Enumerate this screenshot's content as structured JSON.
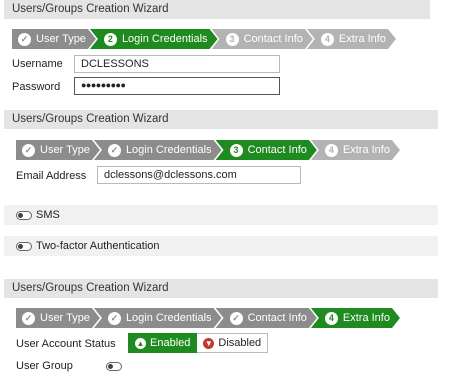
{
  "wizard_title": "Users/Groups Creation Wizard",
  "steps": [
    {
      "num": "",
      "label": "User Type"
    },
    {
      "num": "2",
      "label": "Login Credentials"
    },
    {
      "num": "3",
      "label": "Contact Info"
    },
    {
      "num": "4",
      "label": "Extra Info"
    }
  ],
  "check_glyph": "✓",
  "login": {
    "username_label": "Username",
    "username_value": "DCLESSONS",
    "password_label": "Password",
    "password_value": "●●●●●●●●●"
  },
  "contact": {
    "email_label": "Email Address",
    "email_value": "dclessons@dclessons.com",
    "sms_label": "SMS",
    "twofactor_label": "Two-factor Authentication"
  },
  "extra": {
    "status_label": "User Account Status",
    "enabled_label": "Enabled",
    "disabled_label": "Disabled",
    "group_label": "User Group"
  },
  "colors": {
    "active": "#1f8a1f",
    "done": "#8c8c8c",
    "todo": "#b3b3b3"
  }
}
